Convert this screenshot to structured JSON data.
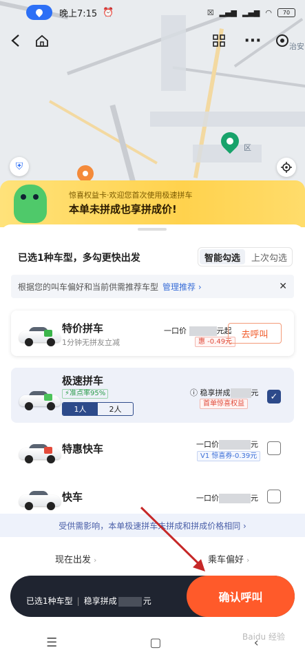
{
  "status_bar": {
    "time": "晚上7:15",
    "battery": "70"
  },
  "map": {
    "place_label_right": "治安",
    "place_label_mid": "区"
  },
  "promo": {
    "subtitle": "惊喜权益卡·欢迎您首次使用极速拼车",
    "title": "本单未拼成也享拼成价!"
  },
  "selection": {
    "title": "已选1种车型，多勾更快出发",
    "toggle_smart": "智能勾选",
    "toggle_last": "上次勾选"
  },
  "tip": {
    "text": "根据您的叫车偏好和当前供需推荐车型",
    "link": "管理推荐 ›",
    "close": "✕"
  },
  "rides": [
    {
      "name": "特价拼车",
      "sub": "1分钟无拼友立减",
      "price_prefix": "一口价",
      "price_suffix": "元起",
      "coupon": "惠 -0.49元",
      "action": "去呼叫"
    },
    {
      "name": "极速拼车",
      "rate": "⚡准点率95%",
      "seats": [
        "1人",
        "2人"
      ],
      "selected_seats": "1人",
      "price_prefix": "稳享拼成",
      "price_suffix": "元",
      "coupon": "首单惊喜权益",
      "checked": true
    },
    {
      "name": "特惠快车",
      "price_prefix": "一口价",
      "price_suffix": "元",
      "coupon": "V1 惊喜券-0.39元",
      "checked": false
    },
    {
      "name": "快车",
      "price_prefix": "一口价",
      "price_suffix": "元",
      "checked": false
    }
  ],
  "notice": "受供需影响，本单极速拼车未拼成和拼成价格相同 ›",
  "options": {
    "depart": "现在出发",
    "preference": "乘车偏好"
  },
  "bottom_bar": {
    "selected": "已选1种车型",
    "price_label": "稳享拼成",
    "price_suffix": "元",
    "confirm": "确认呼叫"
  },
  "watermark": "Baidu 经验",
  "colors": {
    "accent": "#ff5a2a",
    "primary_dark": "#2d4a8a",
    "promo_yellow": "#ffd24d"
  }
}
